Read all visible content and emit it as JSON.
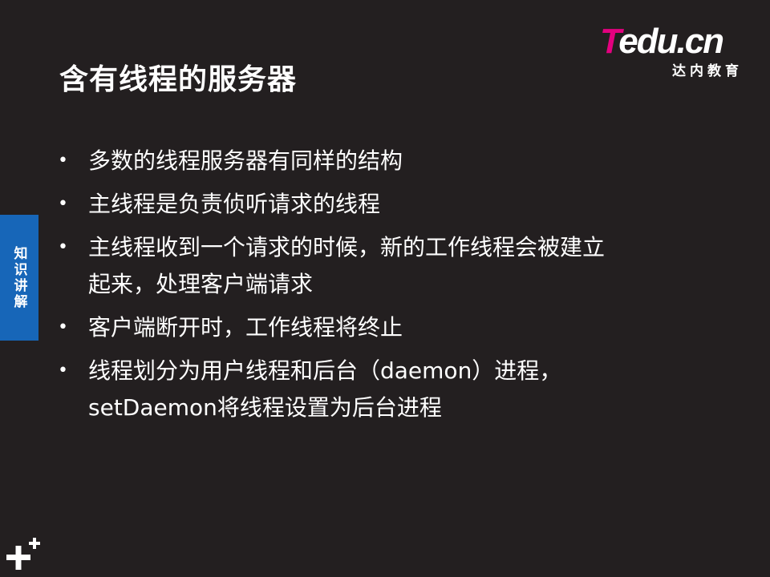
{
  "slide": {
    "title": "含有线程的服务器",
    "logo": {
      "brand_first": "T",
      "brand_rest": "edu.cn",
      "subtitle": "达内教育",
      "accent_color": "#e4007f"
    },
    "side_tab": {
      "label": "知识讲解",
      "color": "#1766b8"
    },
    "bullets": [
      {
        "lines": [
          "多数的线程服务器有同样的结构"
        ]
      },
      {
        "lines": [
          "主线程是负责侦听请求的线程"
        ]
      },
      {
        "lines": [
          "主线程收到一个请求的时候，新的工作线程会被建立",
          "起来，处理客户端请求"
        ]
      },
      {
        "lines": [
          "客户端断开时，工作线程将终止"
        ]
      },
      {
        "lines": [
          "线程划分为用户线程和后台（daemon）进程，",
          "setDaemon将线程设置为后台进程"
        ]
      }
    ],
    "bullet_symbol": "•",
    "corner_icon": "plus-icon"
  }
}
